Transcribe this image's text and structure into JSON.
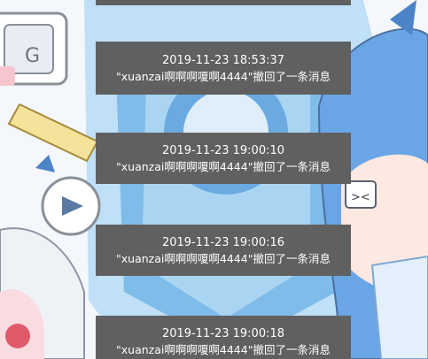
{
  "notices": [
    {
      "time": "2019-11-23 18:53:37",
      "message": "\"xuanzai啊啊啊嗄啊4444\"撤回了一条消息"
    },
    {
      "time": "2019-11-23 19:00:10",
      "message": "\"xuanzai啊啊啊嗄啊4444\"撤回了一条消息"
    },
    {
      "time": "2019-11-23 19:00:16",
      "message": "\"xuanzai啊啊啊嗄啊4444\"撤回了一条消息"
    },
    {
      "time": "2019-11-23 19:00:18",
      "message": "\"xuanzai啊啊啊嗄啊4444\"撤回了一条消息"
    }
  ],
  "colors": {
    "notice_bg": "#606060",
    "notice_text": "#ffffff",
    "accent_blue": "#6aa6e6"
  },
  "icons": [
    "tv-mascot-icon",
    "play-button-icon",
    "ruler-icon",
    "tv-face-icon"
  ]
}
